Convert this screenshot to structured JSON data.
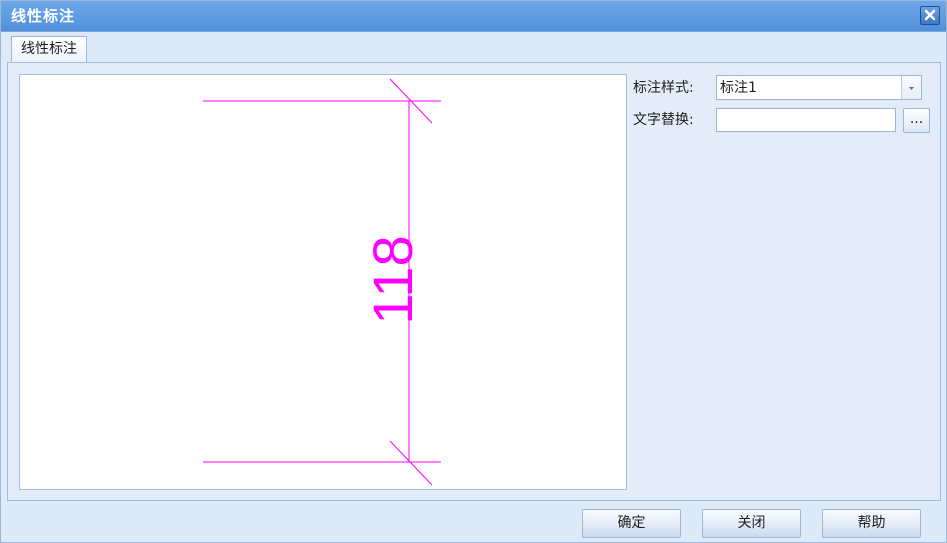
{
  "window": {
    "title": "线性标注",
    "close_icon": "close-icon"
  },
  "tabs": [
    {
      "label": "线性标注"
    }
  ],
  "preview": {
    "dimension_text": "118",
    "line_color": "#ff00ff"
  },
  "form": {
    "style_label": "标注样式:",
    "style_value": "标注1",
    "replace_label": "文字替换:",
    "replace_value": "",
    "browse_label": "..."
  },
  "footer": {
    "confirm_label": "确定",
    "close_label": "关闭",
    "help_label": "帮助"
  }
}
